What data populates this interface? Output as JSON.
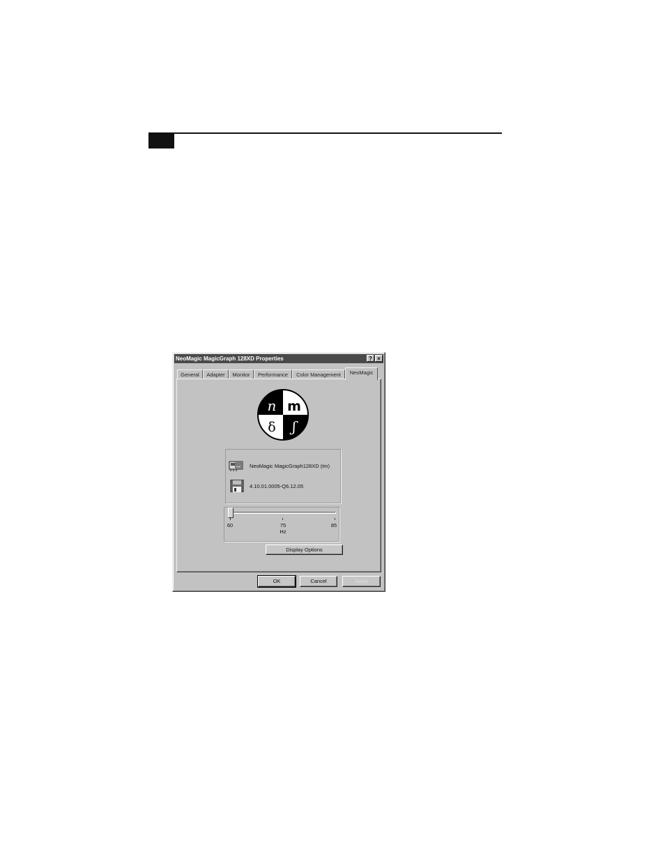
{
  "window": {
    "title": "NeoMagic MagicGraph 128XD Properties",
    "help_glyph": "?",
    "close_glyph": "×"
  },
  "tabs": [
    {
      "label": "General"
    },
    {
      "label": "Adapter"
    },
    {
      "label": "Monitor"
    },
    {
      "label": "Performance"
    },
    {
      "label": "Color Management"
    },
    {
      "label": "NeoMagic",
      "active": true
    }
  ],
  "logo": {
    "icon": "neomagic-logo",
    "letters": [
      "n",
      "m",
      "δ",
      "ʃ"
    ]
  },
  "info": {
    "adapter_icon": "display-adapter-icon",
    "adapter_name": "NeoMagic MagicGraph128XD (tm)",
    "driver_icon": "floppy-disk-icon",
    "driver_version": "4.10.01.0005-Q6.12.05"
  },
  "refresh_slider": {
    "min_label": "60",
    "mid_label": "75",
    "max_label": "85",
    "unit": "Hz",
    "value": 60
  },
  "buttons": {
    "display_options": "Display Options",
    "ok": "OK",
    "cancel": "Cancel",
    "apply": "Apply"
  }
}
